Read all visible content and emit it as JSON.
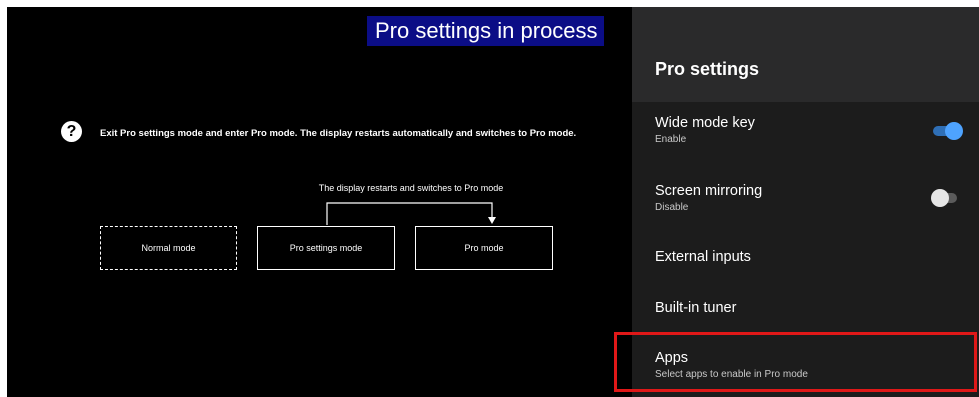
{
  "banner": {
    "text": "Pro settings in process"
  },
  "help": {
    "icon": "question-icon",
    "text": "Exit Pro settings mode and enter Pro mode. The display restarts automatically and switches to Pro mode."
  },
  "diagram": {
    "caption": "The display restarts and switches to Pro mode",
    "boxes": {
      "normal": "Normal mode",
      "settings": "Pro settings mode",
      "pro": "Pro mode"
    }
  },
  "panel": {
    "title": "Pro settings",
    "items": [
      {
        "label": "Wide mode key",
        "sub": "Enable",
        "toggle": "on"
      },
      {
        "label": "Screen mirroring",
        "sub": "Disable",
        "toggle": "off"
      },
      {
        "label": "External inputs"
      },
      {
        "label": "Built-in tuner"
      },
      {
        "label": "Apps",
        "sub": "Select apps to enable in Pro mode"
      }
    ]
  },
  "colors": {
    "banner_bg": "#0b0d86",
    "highlight": "#e01818",
    "toggle_on": "#4ea3ff"
  }
}
